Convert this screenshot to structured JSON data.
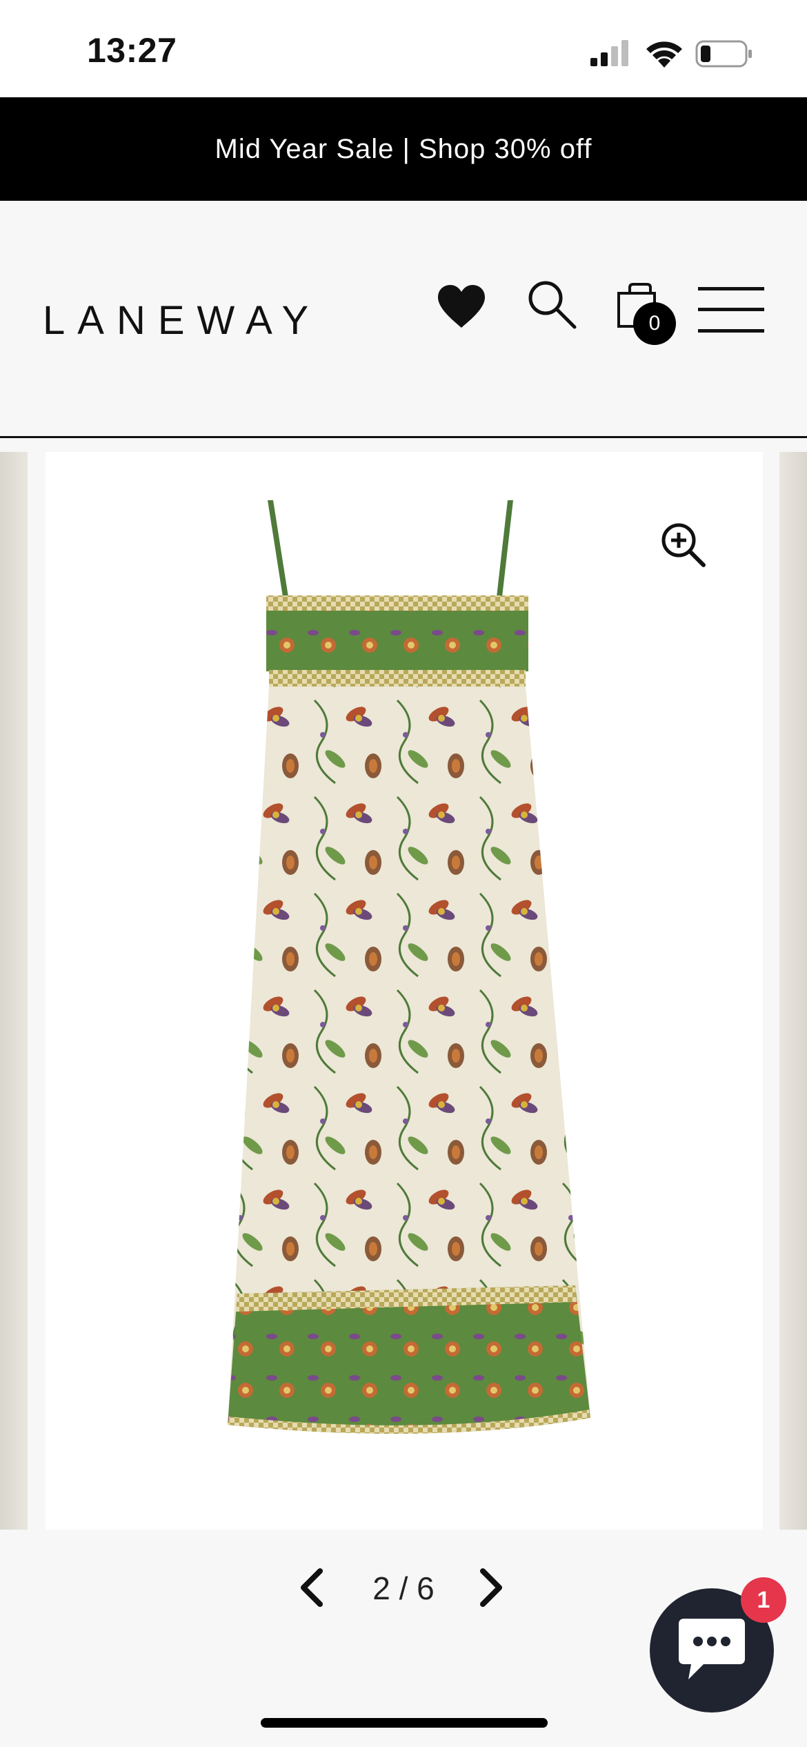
{
  "status_bar": {
    "time": "13:27"
  },
  "promo": {
    "text": "Mid Year Sale | Shop 30% off"
  },
  "header": {
    "logo": "LANEWAY",
    "cart_count": "0"
  },
  "icons": {
    "wishlist": "heart-icon",
    "search": "search-icon",
    "cart": "cart-icon",
    "menu": "hamburger-menu-icon",
    "zoom": "zoom-in-icon",
    "prev": "chevron-left-icon",
    "next": "chevron-right-icon",
    "chat": "chat-bubble-icon"
  },
  "gallery": {
    "current": 2,
    "total": 6,
    "indicator": "2 / 6"
  },
  "chat": {
    "badge": "1"
  },
  "colors": {
    "banner": "#000000",
    "badge": "#e5364c",
    "chat": "#1f2430",
    "dress_green": "#5c8a3f",
    "dress_cream": "#ece7d6"
  }
}
